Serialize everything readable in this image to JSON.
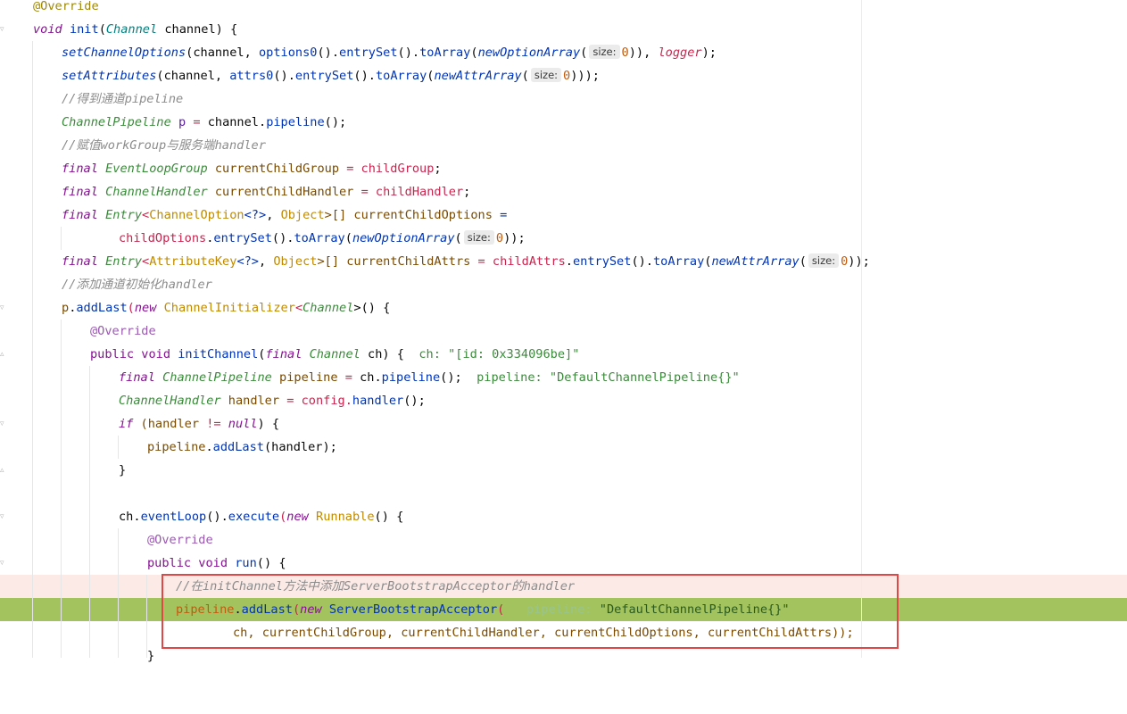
{
  "editor": {
    "highlight_colors": {
      "current_line": "#fbeae6",
      "execution_line": "#a3c35f",
      "selection_box": "#e04848"
    },
    "inlay_hints": {
      "size": "size:"
    },
    "lines": {
      "l1": "@Override",
      "l2a": "void",
      "l2b": "init",
      "l2c": "(",
      "l2d": "Channel",
      "l2e": " channel) {",
      "l3a": "setChannelOptions",
      "l3b": "(channel, ",
      "l3c": "options0",
      "l3d": "().",
      "l3e": "entrySet",
      "l3f": "().",
      "l3g": "toArray",
      "l3h": "(",
      "l3i": "newOptionArray",
      "l3j": "(",
      "l3k": "0",
      "l3l": ")), ",
      "l3m": "logger",
      "l3n": ");",
      "l4a": "setAttributes",
      "l4b": "(channel, ",
      "l4c": "attrs0",
      "l4d": "().",
      "l4e": "entrySet",
      "l4f": "().",
      "l4g": "toArray",
      "l4h": "(",
      "l4i": "newAttrArray",
      "l4j": "(",
      "l4k": "0",
      "l4l": ")));",
      "l5": "//得到通道pipeline",
      "l6a": "ChannelPipeline",
      "l6b": " p ",
      "l6c": "=",
      "l6d": " channel.",
      "l6e": "pipeline",
      "l6f": "();",
      "l7": "//赋值workGroup与服务端handler",
      "l8a": "final",
      "l8b": "EventLoopGroup",
      "l8c": " currentChildGroup ",
      "l8d": "=",
      "l8e": " childGroup",
      "l8f": ";",
      "l9a": "final",
      "l9b": "ChannelHandler",
      "l9c": " currentChildHandler ",
      "l9d": "=",
      "l9e": " childHandler",
      "l9f": ";",
      "l10a": "final",
      "l10b": "Entry",
      "l10c": "<",
      "l10d": "ChannelOption",
      "l10e": "<?>",
      "l10f": ", ",
      "l10g": "Object",
      "l10h": ">[] currentChildOptions ",
      "l10i": "=",
      "l11a": "childOptions",
      "l11b": ".",
      "l11c": "entrySet",
      "l11d": "().",
      "l11e": "toArray",
      "l11f": "(",
      "l11g": "newOptionArray",
      "l11h": "(",
      "l11i": "0",
      "l11j": "));",
      "l12a": "final",
      "l12b": "Entry",
      "l12c": "<",
      "l12d": "AttributeKey",
      "l12e": "<?>",
      "l12f": ", ",
      "l12g": "Object",
      "l12h": ">[] currentChildAttrs ",
      "l12i": "=",
      "l12j": " childAttrs",
      "l12k": ".",
      "l12l": "entrySet",
      "l12m": "().",
      "l12n": "toArray",
      "l12o": "(",
      "l12p": "newAttrArray",
      "l12q": "(",
      "l12r": "0",
      "l12s": "));",
      "l13": "//添加通道初始化handler",
      "l14a": "p",
      "l14b": ".",
      "l14c": "addLast",
      "l14d": "(",
      "l14e": "new",
      "l14f": "ChannelInitializer",
      "l14g": "<",
      "l14h": "Channel",
      "l14i": ">() {",
      "l15": "@Override",
      "l16a": "public",
      "l16b": "void",
      "l16c": "initChannel",
      "l16d": "(",
      "l16e": "final",
      "l16f": "Channel",
      "l16g": " ch) {",
      "l16h": "ch: \"[id: 0x334096be]\"",
      "l17a": "final",
      "l17b": "ChannelPipeline",
      "l17c": " pipeline ",
      "l17d": "=",
      "l17e": " ch.",
      "l17f": "pipeline",
      "l17g": "();",
      "l17h": "pipeline: \"DefaultChannelPipeline{}\"",
      "l18a": "ChannelHandler",
      "l18b": " handler ",
      "l18c": "=",
      "l18d": " config.",
      "l18e": "handler",
      "l18f": "();",
      "l19a": "if",
      "l19b": " (handler ",
      "l19c": "!=",
      "l19d": "null",
      "l19e": ") {",
      "l20a": "pipeline",
      "l20b": ".",
      "l20c": "addLast",
      "l20d": "(handler);",
      "l21": "}",
      "l22a": "ch.",
      "l22b": "eventLoop",
      "l22c": "().",
      "l22d": "execute",
      "l22e": "(",
      "l22f": "new",
      "l22g": "Runnable",
      "l22h": "() {",
      "l23": "@Override",
      "l24a": "public",
      "l24b": "void",
      "l24c": "run",
      "l24d": "() {",
      "l25": "//在initChannel方法中添加ServerBootstrapAcceptor的handler",
      "l26a": "pipeline",
      "l26b": ".",
      "l26c": "addLast",
      "l26d": "(",
      "l26e": "new",
      "l26f": "ServerBootstrapAcceptor",
      "l26g": "(",
      "l26h": "pipeline:",
      "l26i": "\"DefaultChannelPipeline{}\"",
      "l27": "ch, currentChildGroup, currentChildHandler, currentChildOptions, currentChildAttrs));",
      "l28": "}"
    }
  }
}
